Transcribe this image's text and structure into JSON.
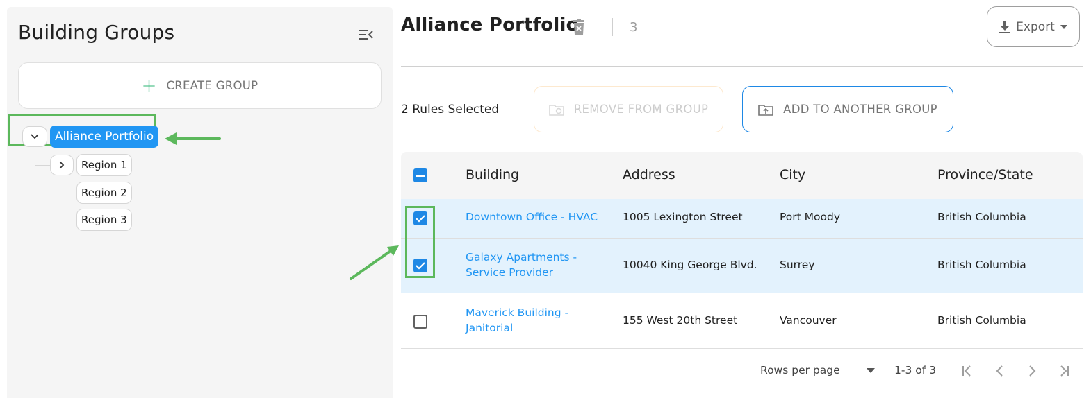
{
  "sidebar": {
    "title": "Building Groups",
    "create_group": {
      "icon": "plus-icon",
      "label": "CREATE GROUP"
    },
    "tree": {
      "root": {
        "label": "Alliance Portfolio",
        "expanded": true
      },
      "children": [
        {
          "label": "Region 1",
          "has_children": true
        },
        {
          "label": "Region 2",
          "has_children": false
        },
        {
          "label": "Region 3",
          "has_children": false
        }
      ]
    }
  },
  "header": {
    "title": "Alliance Portfolio",
    "count": "3",
    "export_label": "Export"
  },
  "actions": {
    "selected_text": "2 Rules Selected",
    "remove_label": "REMOVE FROM GROUP",
    "add_label": "ADD TO ANOTHER GROUP"
  },
  "table": {
    "columns": [
      "Building",
      "Address",
      "City",
      "Province/State"
    ],
    "rows": [
      {
        "selected": true,
        "building": [
          "Downtown Office - HVAC"
        ],
        "address": "1005 Lexington Street",
        "city": "Port Moody",
        "province": "British Columbia"
      },
      {
        "selected": true,
        "building": [
          "Galaxy Apartments -",
          "Service Provider"
        ],
        "address": "10040 King George Blvd.",
        "city": "Surrey",
        "province": "British Columbia"
      },
      {
        "selected": false,
        "building": [
          "Maverick Building -",
          "Janitorial"
        ],
        "address": "155 West 20th Street",
        "city": "Vancouver",
        "province": "British Columbia"
      }
    ]
  },
  "pagination": {
    "rows_per_page_label": "Rows per page",
    "range": "1-3 of 3"
  },
  "colors": {
    "accent": "#2196f3",
    "highlight_annotation": "#5cb85c",
    "selected_row": "#e3f2fd",
    "create_plus": "#2bb673"
  }
}
